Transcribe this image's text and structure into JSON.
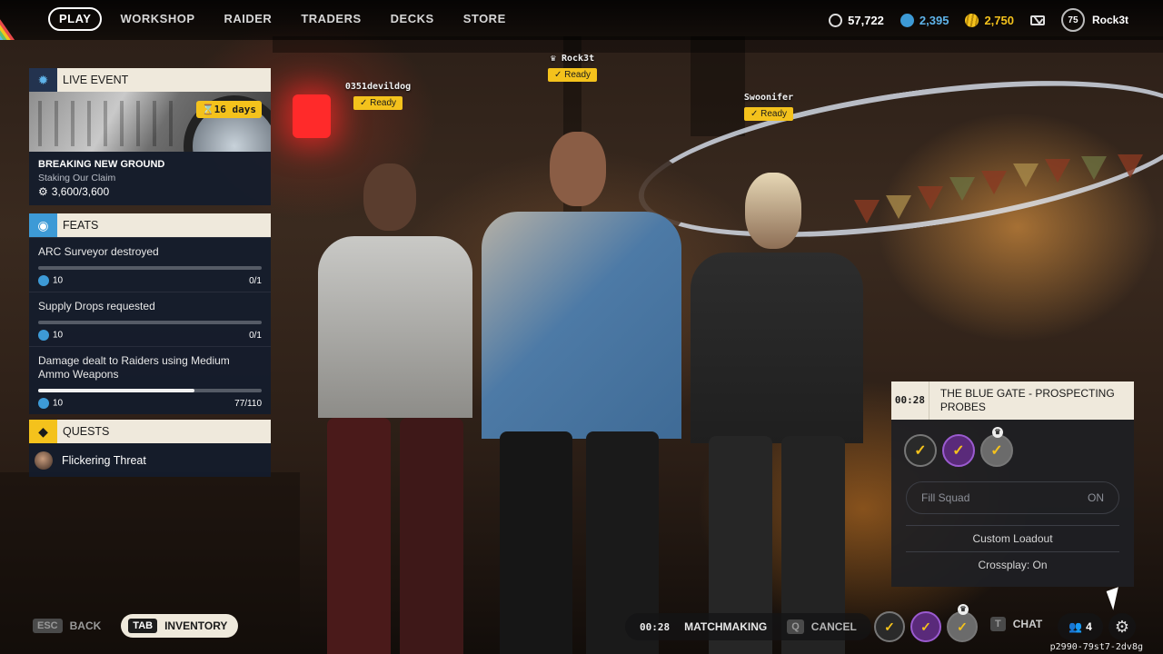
{
  "nav": {
    "items": [
      "PLAY",
      "WORKSHOP",
      "RAIDER",
      "TRADERS",
      "DECKS",
      "STORE"
    ]
  },
  "currencies": [
    {
      "icon": "cred-icon",
      "value": "57,722",
      "color": "#ffffff"
    },
    {
      "icon": "blue-coin-icon",
      "value": "2,395",
      "color": "#5fb4ea"
    },
    {
      "icon": "gold-coin-icon",
      "value": "2,750",
      "color": "#f4c21c"
    }
  ],
  "profile": {
    "level": "75",
    "name": "Rock3t"
  },
  "live_event": {
    "header": "LIVE EVENT",
    "badge": "⌛16 days",
    "title": "BREAKING NEW GROUND",
    "subtitle": "Staking Our Claim",
    "progress": "3,600/3,600"
  },
  "feats": {
    "header": "FEATS",
    "items": [
      {
        "name": "ARC Surveyor destroyed",
        "reward": "10",
        "progress": "0/1",
        "fraction": 0
      },
      {
        "name": "Supply Drops requested",
        "reward": "10",
        "progress": "0/1",
        "fraction": 0
      },
      {
        "name": "Damage dealt to Raiders using Medium Ammo Weapons",
        "reward": "10",
        "progress": "77/110",
        "fraction": 0.7
      }
    ]
  },
  "quests": {
    "header": "QUESTS",
    "items": [
      {
        "name": "Flickering Threat"
      }
    ]
  },
  "players": [
    {
      "name": "0351devildog",
      "status": "Ready"
    },
    {
      "name": "Rock3t",
      "status": "Ready"
    },
    {
      "name": "Swoonifer",
      "status": "Ready"
    }
  ],
  "squad_panel": {
    "timer": "00:28",
    "map": "THE BLUE GATE - PROSPECTING PROBES",
    "fill_squad_label": "Fill Squad",
    "fill_squad_value": "ON",
    "custom_loadout": "Custom Loadout",
    "crossplay": "Crossplay: On"
  },
  "bottom": {
    "back_key": "ESC",
    "back_label": "BACK",
    "inventory_key": "TAB",
    "inventory_label": "INVENTORY",
    "mm_time": "00:28",
    "mm_label": "MATCHMAKING",
    "cancel_key": "Q",
    "cancel_label": "CANCEL",
    "chat_key": "T",
    "chat_label": "CHAT",
    "squad_count": "4",
    "build": "p2990-79st7-2dv8g"
  },
  "colors": {
    "accent": "#f4c21c",
    "panel_header": "#efe9dc",
    "panel_body": "#141c2d",
    "blue": "#3d9ad6"
  }
}
